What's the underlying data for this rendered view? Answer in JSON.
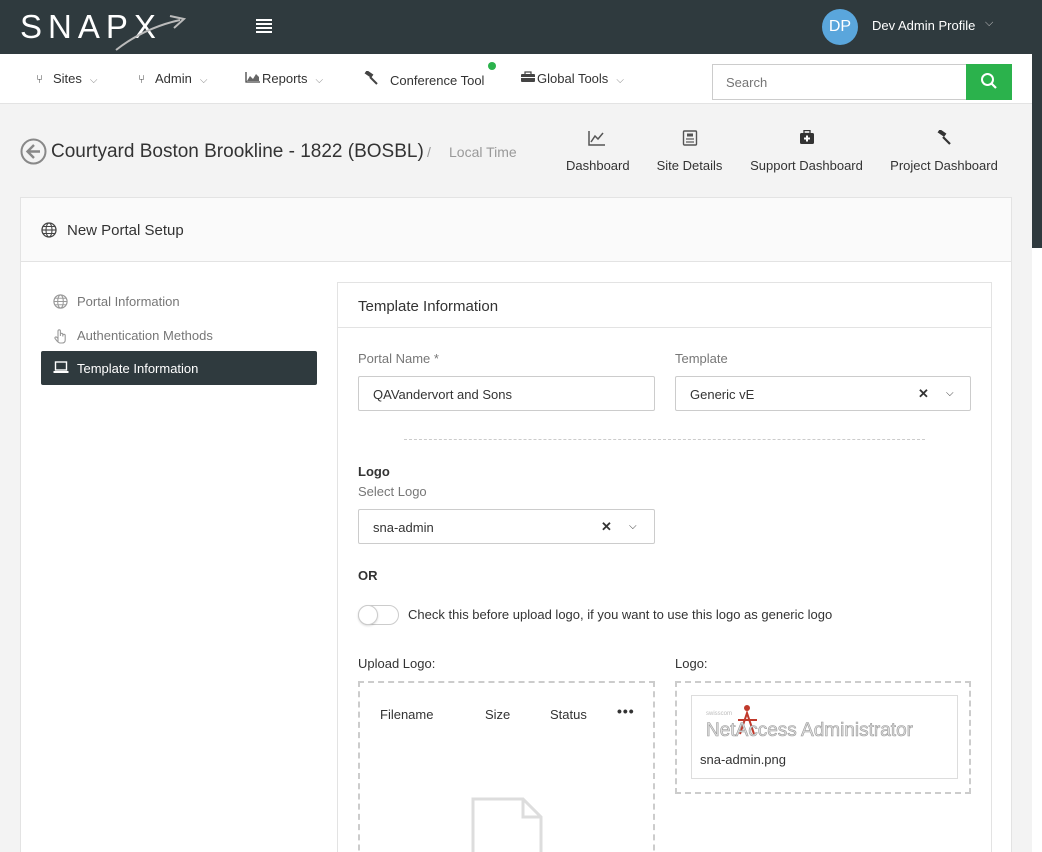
{
  "header": {
    "logo_text": "SNAPX",
    "user_initials": "DP",
    "user_name": "Dev Admin Profile"
  },
  "nav": {
    "items": [
      {
        "label": "Sites",
        "icon": "branch-icon"
      },
      {
        "label": "Admin",
        "icon": "branch-icon"
      },
      {
        "label": "Reports",
        "icon": "area-chart-icon"
      },
      {
        "label": "Conference Tool",
        "icon": "gavel-icon"
      },
      {
        "label": "Global Tools",
        "icon": "briefcase-icon"
      }
    ],
    "search_placeholder": "Search",
    "status_dot_color": "#2bb24c"
  },
  "page": {
    "site_title": "Courtyard Boston Brookline - 1822 (BOSBL)",
    "separator": "/",
    "local_time_label": "Local Time",
    "quick_links": [
      {
        "label": "Dashboard",
        "icon": "line-chart-icon"
      },
      {
        "label": "Site Details",
        "icon": "document-icon"
      },
      {
        "label": "Support Dashboard",
        "icon": "medkit-icon"
      },
      {
        "label": "Project Dashboard",
        "icon": "gavel-icon"
      }
    ]
  },
  "card": {
    "title": "New Portal Setup",
    "steps": [
      {
        "label": "Portal Information",
        "icon": "globe-icon",
        "active": false
      },
      {
        "label": "Authentication Methods",
        "icon": "pointer-hand-icon",
        "active": false
      },
      {
        "label": "Template Information",
        "icon": "laptop-icon",
        "active": true
      }
    ]
  },
  "template_panel": {
    "title": "Template Information",
    "portal_name_label": "Portal Name *",
    "portal_name_value": "QAVandervort and Sons",
    "template_label": "Template",
    "template_value": "Generic vE",
    "logo_heading": "Logo",
    "select_logo_label": "Select Logo",
    "select_logo_value": "sna-admin",
    "or_label": "OR",
    "generic_logo_toggle_text": "Check this before upload logo, if you want to use this logo as generic logo",
    "generic_logo_toggle_on": false,
    "upload_logo_label": "Upload Logo:",
    "upload_columns": [
      "Filename",
      "Size",
      "Status"
    ],
    "more_label": "•••",
    "logo_label": "Logo:",
    "logo_filename": "sna-admin.png",
    "logo_image_text": "NetAccess Administrator"
  },
  "colors": {
    "header_bg": "#2f3a3e",
    "accent_green": "#2bb24c",
    "avatar_bg": "#5aa6dc"
  }
}
